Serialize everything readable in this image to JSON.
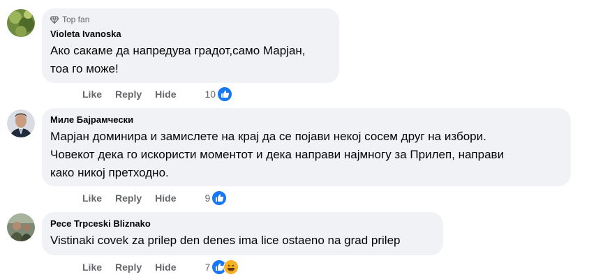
{
  "comments": [
    {
      "badge": "Top fan",
      "author": "Violeta Ivanoska",
      "lines": [
        "Ако сакаме да напредува градот,само Марјан,",
        "тоа го може!"
      ],
      "actions": {
        "like": "Like",
        "reply": "Reply",
        "hide": "Hide"
      },
      "reaction_count": "10",
      "reactions": [
        "like-icon"
      ]
    },
    {
      "author": "Миле Бајрамчески",
      "lines": [
        "Марјан доминира и замислете на крај да се појави некој сосем друг на избори.",
        "Човекот дека го искористи моментот и дека направи најмногу за Прилеп, направи",
        "како никој претходно."
      ],
      "actions": {
        "like": "Like",
        "reply": "Reply",
        "hide": "Hide"
      },
      "reaction_count": "9",
      "reactions": [
        "like-icon"
      ]
    },
    {
      "author": "Pece Trpceski Bliznako",
      "lines": [
        "Vistinaki covek za prilep den denes ima lice ostaeno na grad prilep"
      ],
      "actions": {
        "like": "Like",
        "reply": "Reply",
        "hide": "Hide"
      },
      "reaction_count": "7",
      "reactions": [
        "like-icon",
        "haha-icon"
      ]
    }
  ],
  "colors": {
    "bubble": "#f0f2f5",
    "muted_text": "#65676b",
    "like_blue": "#1877f2",
    "haha_yellow": "#f7b125"
  }
}
